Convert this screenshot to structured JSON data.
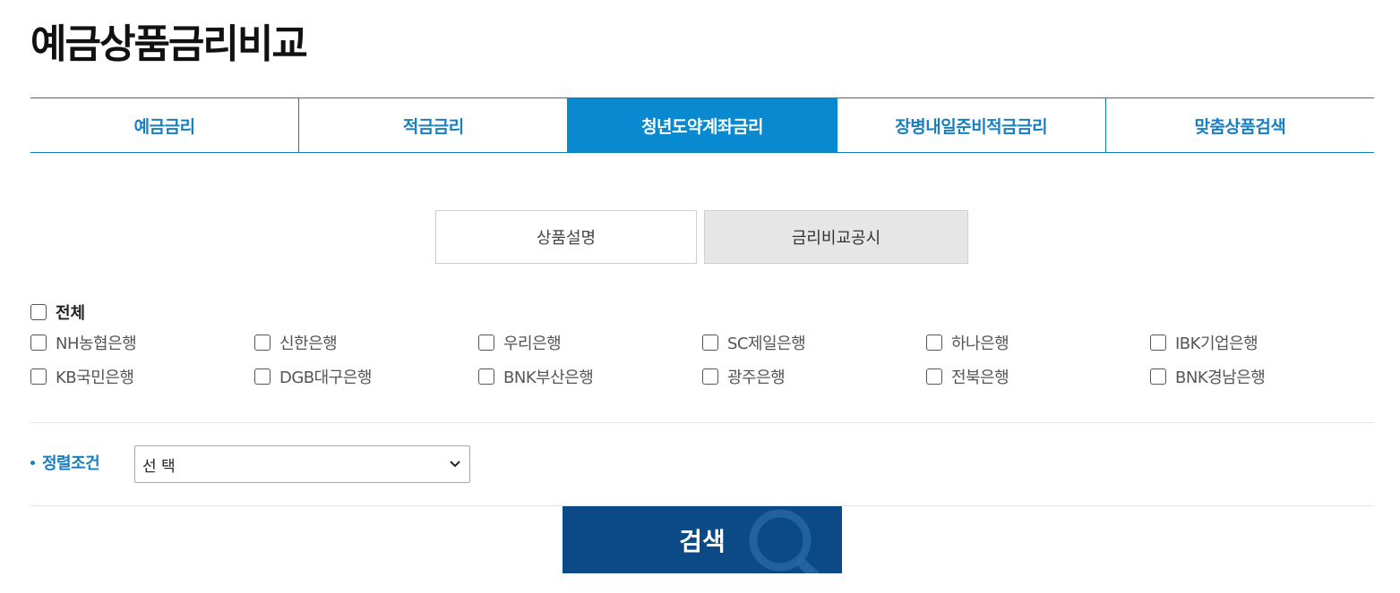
{
  "title": "예금상품금리비교",
  "tabs": [
    {
      "label": "예금금리",
      "active": false
    },
    {
      "label": "적금금리",
      "active": false
    },
    {
      "label": "청년도약계좌금리",
      "active": true
    },
    {
      "label": "장병내일준비적금금리",
      "active": false
    },
    {
      "label": "맞춤상품검색",
      "active": false
    }
  ],
  "subtabs": [
    {
      "label": "상품설명",
      "active": false
    },
    {
      "label": "금리비교공시",
      "active": true
    }
  ],
  "check_all": {
    "label": "전체",
    "checked": false
  },
  "banks": [
    {
      "label": "NH농협은행",
      "checked": false
    },
    {
      "label": "신한은행",
      "checked": false
    },
    {
      "label": "우리은행",
      "checked": false
    },
    {
      "label": "SC제일은행",
      "checked": false
    },
    {
      "label": "하나은행",
      "checked": false
    },
    {
      "label": "IBK기업은행",
      "checked": false
    },
    {
      "label": "KB국민은행",
      "checked": false
    },
    {
      "label": "DGB대구은행",
      "checked": false
    },
    {
      "label": "BNK부산은행",
      "checked": false
    },
    {
      "label": "광주은행",
      "checked": false
    },
    {
      "label": "전북은행",
      "checked": false
    },
    {
      "label": "BNK경남은행",
      "checked": false
    }
  ],
  "sort": {
    "label": "정렬조건",
    "selected": "선 택"
  },
  "search_button": {
    "label": "검색"
  },
  "colors": {
    "accent": "#0989cf",
    "tab_text": "#1a7fc0",
    "button": "#0c4a87"
  }
}
